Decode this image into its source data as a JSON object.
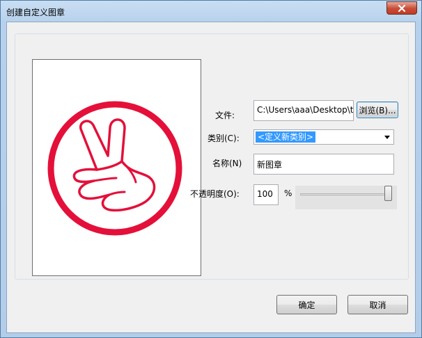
{
  "window": {
    "title": "创建自定义图章"
  },
  "form": {
    "file_label": "文件:",
    "file_value": "C:\\Users\\aaa\\Desktop\\tin",
    "browse_label": "浏览(B)...",
    "category_label": "类别(C):",
    "category_value": "<定义新类别>",
    "name_label": "名称(N)",
    "name_value": "新图章",
    "opacity_label": "不透明度(O):",
    "opacity_value": "100",
    "opacity_unit": "%",
    "opacity_slider_fraction": 1.0
  },
  "buttons": {
    "ok_label": "确定",
    "cancel_label": "取消"
  },
  "icons": {
    "close": "close-icon",
    "stamp": "peace-hand-stamp-icon",
    "dropdown": "chevron-down-icon"
  },
  "colors": {
    "stamp": "#e4103a",
    "selection": "#3399ff"
  }
}
